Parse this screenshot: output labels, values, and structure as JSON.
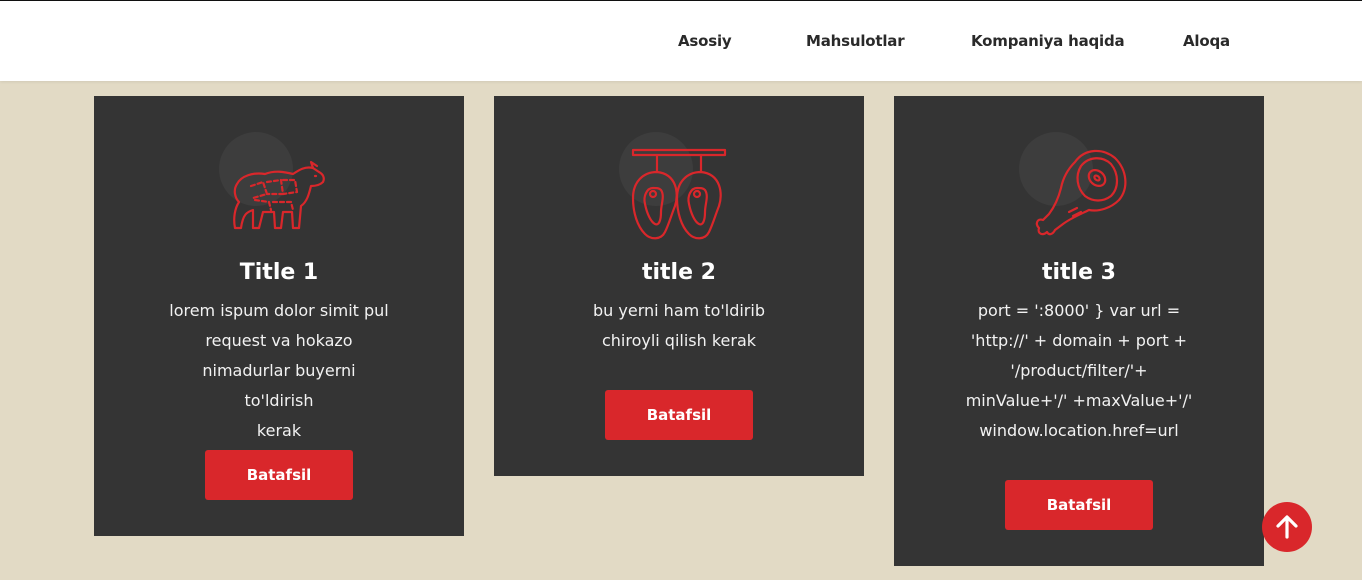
{
  "nav": {
    "items": [
      {
        "label": "Asosiy"
      },
      {
        "label": "Mahsulotlar"
      },
      {
        "label": "Kompaniya haqida"
      },
      {
        "label": "Aloqa"
      }
    ]
  },
  "cards": [
    {
      "icon": "cow-cuts-icon",
      "title": "Title 1",
      "lines": [
        "lorem ispum dolor simit pul",
        "request va hokazo",
        "nimadurlar buyerni to'ldirish",
        "kerak"
      ],
      "button_label": "Batafsil"
    },
    {
      "icon": "hanging-steaks-icon",
      "title": "title 2",
      "lines": [
        "bu yerni ham to'ldirib",
        "chiroyli qilish kerak"
      ],
      "button_label": "Batafsil"
    },
    {
      "icon": "ham-leg-icon",
      "title": "title 3",
      "lines": [
        "port = ':8000' } var url =",
        "'http://' + domain + port +",
        "'/product/filter/'+",
        "minValue+'/' +maxValue+'/'",
        "window.location.href=url"
      ],
      "button_label": "Batafsil"
    }
  ],
  "scroll_top": {
    "icon": "arrow-up-icon"
  },
  "colors": {
    "accent": "#d9272b",
    "card_bg": "#343434",
    "page_bg": "#e2dac5",
    "nav_bg": "#ffffff"
  }
}
